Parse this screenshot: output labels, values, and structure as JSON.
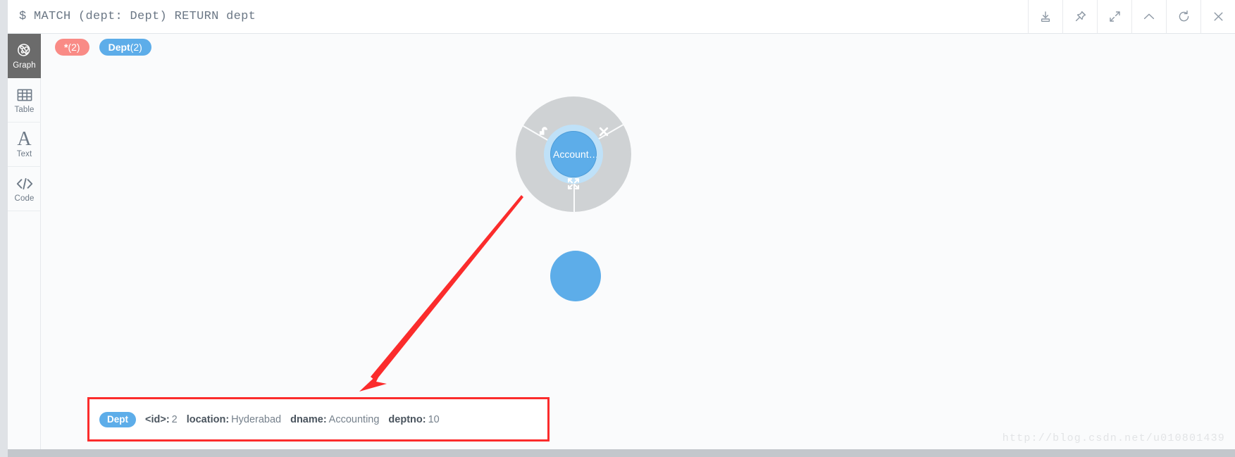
{
  "header": {
    "prompt_symbol": "$",
    "query": "MATCH (dept: Dept) RETURN dept",
    "toolbar": [
      {
        "name": "download-icon",
        "label": "Download"
      },
      {
        "name": "pin-icon",
        "label": "Pin"
      },
      {
        "name": "expand-icon",
        "label": "Expand"
      },
      {
        "name": "chevron-up-icon",
        "label": "Collapse"
      },
      {
        "name": "refresh-icon",
        "label": "Refresh"
      },
      {
        "name": "close-icon",
        "label": "Close"
      }
    ]
  },
  "sidebar": {
    "items": [
      {
        "label": "Graph",
        "icon": "graph-icon",
        "active": true
      },
      {
        "label": "Table",
        "icon": "table-icon",
        "active": false
      },
      {
        "label": "Text",
        "icon": "text-icon",
        "active": false
      },
      {
        "label": "Code",
        "icon": "code-icon",
        "active": false
      }
    ]
  },
  "legend": {
    "chips": [
      {
        "label": "*",
        "count": "(2)",
        "color": "#f98b86"
      },
      {
        "label": "Dept",
        "count": "(2)",
        "color": "#5dade9"
      }
    ]
  },
  "graph": {
    "node_color": "#5dade9",
    "halo_color": "#bfe1f8",
    "ring_color": "#cfd2d4",
    "nodes": [
      {
        "name": "node-account",
        "label": "Account…",
        "selected": true
      },
      {
        "name": "node-secondary",
        "label": "",
        "selected": false
      }
    ],
    "ring_menu": {
      "actions": [
        {
          "name": "unlock-icon",
          "label": "Unlock"
        },
        {
          "name": "dismiss-icon",
          "label": "Dismiss"
        },
        {
          "name": "expand-node-icon",
          "label": "Expand node"
        }
      ]
    }
  },
  "properties": {
    "chip": {
      "label": "Dept",
      "color": "#5dade9"
    },
    "items": [
      {
        "key": "<id>:",
        "value": "2"
      },
      {
        "key": "location:",
        "value": "Hyderabad"
      },
      {
        "key": "dname:",
        "value": "Accounting"
      },
      {
        "key": "deptno:",
        "value": "10"
      }
    ]
  },
  "annotation": {
    "color": "#fb2c2c",
    "arrow_label": "pointer-arrow",
    "box_label": "highlight-box"
  },
  "watermark": {
    "text": "http://blog.csdn.net/u010801439"
  }
}
